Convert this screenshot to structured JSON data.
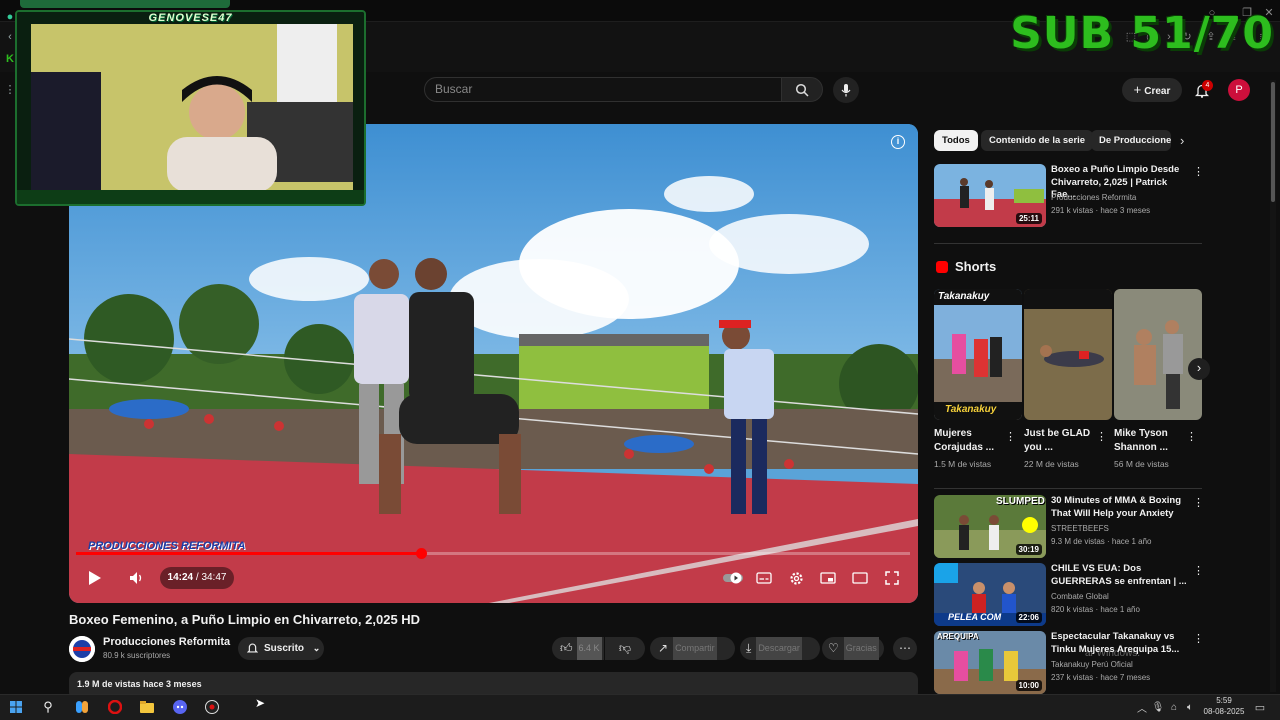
{
  "overlay": {
    "sub_counter": "SUB 51/70",
    "webcam_name": "GENOVESE47"
  },
  "header": {
    "search_placeholder": "Buscar",
    "create_label": "Crear",
    "notification_count": "4",
    "avatar_letter": "P"
  },
  "player": {
    "time_current": "14:24",
    "time_total": "34:47",
    "progress": 0.414,
    "time_display": "14:24 / 34:47",
    "watermark_text": "PRODUCCIONES REFORMITA"
  },
  "video": {
    "title": "Boxeo Femenino, a Puño Limpio en Chivarreto, 2,025 HD",
    "channel": "Producciones  Reformita",
    "subscribers": "80.9 k suscriptores",
    "subscribe_label": "Suscrito",
    "likes": "6.4 K",
    "share_label": "Compartir",
    "download_label": "Descargar",
    "thanks_label": "Gracias",
    "description_meta": "1.9 M de vistas  hace 3 meses"
  },
  "chips": [
    "Todos",
    "Contenido de la serie",
    "De Produccione"
  ],
  "related_top": {
    "title": "Boxeo a Puño Limpio Desde Chivarreto, 2,025 | Patrick Fae...",
    "channel": "Producciones Reformita",
    "meta": "291 k vistas · hace 3 meses",
    "duration": "25:11"
  },
  "shorts": {
    "heading": "Shorts",
    "items": [
      {
        "title": "Mujeres Corajudas ...",
        "views": "1.5 M de vistas"
      },
      {
        "title": "Just be GLAD you ...",
        "views": "22 M de vistas"
      },
      {
        "title": "Mike Tyson Shannon ...",
        "views": "56 M de vistas"
      }
    ],
    "thumb_text_1": "Takanakuy",
    "thumb_text_2": "Takanakuy"
  },
  "related": [
    {
      "title": "30 Minutes of MMA & Boxing That Will Help your Anxiety",
      "channel": "STREETBEEFS",
      "meta": "9.3 M de vistas · hace 1 año",
      "duration": "30:19",
      "thumb_text": "SLUMPED"
    },
    {
      "title": "CHILE VS EUA: Dos GUERRERAS se enfrentan | ...",
      "channel": "Combate Global",
      "meta": "820 k vistas · hace 1 año",
      "duration": "22:06",
      "thumb_text": "PELEA COM"
    },
    {
      "title": "Espectacular Takanakuy vs Tinku Mujeres Arequipa 15...",
      "channel": "Takanakuy Perú Oficial",
      "meta": "237 k vistas · hace 7 meses",
      "duration": "10:00",
      "thumb_text": "AREQUIPA"
    }
  ],
  "system": {
    "watermark": "ar Windows.",
    "time": "5:59",
    "date": "08-08-2025"
  },
  "colors": {
    "accent_red": "#ff0000",
    "overlay_green": "#2dbd1e",
    "bg": "#0f0f0f"
  }
}
